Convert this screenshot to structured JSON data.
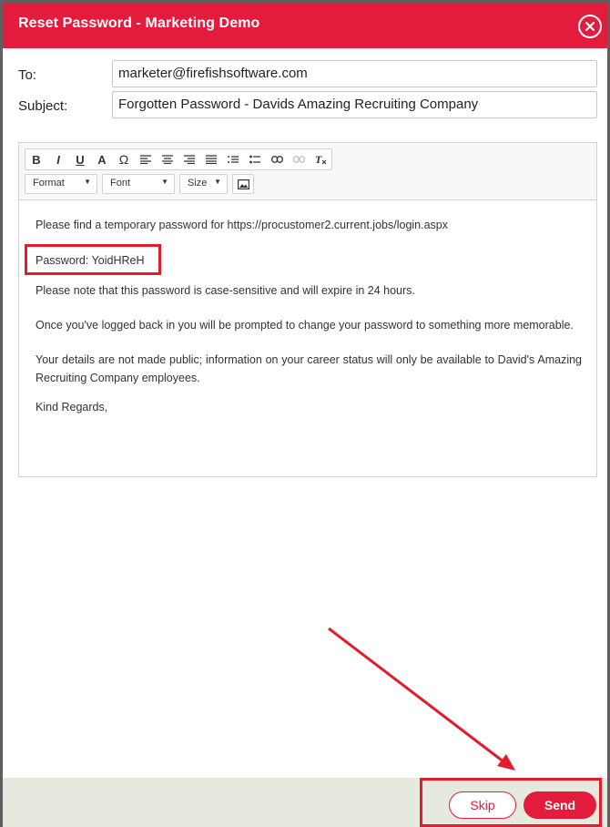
{
  "dialog": {
    "title": "Reset Password - Marketing Demo",
    "close_icon": "close-icon"
  },
  "fields": {
    "to_label": "To:",
    "to_value": "marketer@firefishsoftware.com",
    "subject_label": "Subject:",
    "subject_value": "Forgotten Password - Davids Amazing Recruiting Company"
  },
  "toolbar": {
    "buttons": [
      "B",
      "I",
      "U",
      "A",
      "Ω"
    ],
    "combos": {
      "format": "Format",
      "font": "Font",
      "size": "Size"
    }
  },
  "body": {
    "line1": "Please find a temporary password for https://procustomer2.current.jobs/login.aspx",
    "password_line": "Password: YoidHReH",
    "line3": "Please note that this password is case-sensitive and will expire in 24 hours.",
    "line4": "Once you've logged back in you will be prompted to change your password to something more memorable.",
    "line5": "Your details are not made public; information on your career status will only be available to David's Amazing Recruiting Company employees.",
    "signoff": "Kind Regards,"
  },
  "footer": {
    "skip_label": "Skip",
    "send_label": "Send"
  },
  "colors": {
    "brand": "#e31b3c",
    "annotation": "#e31b2c",
    "footer_bg": "#e6e9de"
  }
}
